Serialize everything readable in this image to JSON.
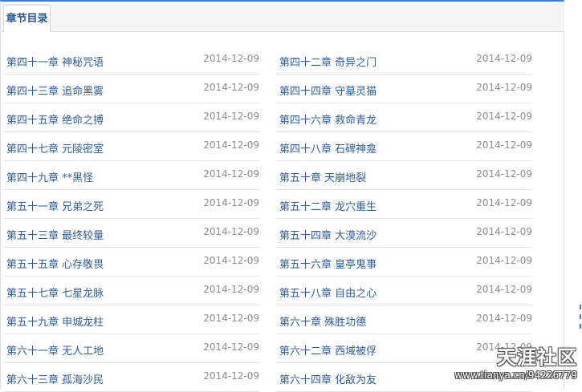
{
  "tab": {
    "label": "章节目录"
  },
  "chapters_left": [
    {
      "title": "第四十一章 神秘咒语",
      "date": "2014-12-09"
    },
    {
      "title": "第四十三章 追命黑雾",
      "date": "2014-12-09"
    },
    {
      "title": "第四十五章 绝命之搏",
      "date": "2014-12-09"
    },
    {
      "title": "第四十七章 元陵密室",
      "date": "2014-12-09"
    },
    {
      "title": "第四十九章 **黑怪",
      "date": "2014-12-09"
    },
    {
      "title": "第五十一章 兄弟之死",
      "date": "2014-12-09"
    },
    {
      "title": "第五十三章 最终较量",
      "date": "2014-12-09"
    },
    {
      "title": "第五十五章 心存敬畏",
      "date": "2014-12-09"
    },
    {
      "title": "第五十七章 七星龙脉",
      "date": "2014-12-09"
    },
    {
      "title": "第五十九章 申城龙柱",
      "date": "2014-12-09"
    },
    {
      "title": "第六十一章 无人工地",
      "date": "2014-12-09"
    },
    {
      "title": "第六十三章 孤海沙民",
      "date": "2014-12-09"
    }
  ],
  "chapters_right": [
    {
      "title": "第四十二章 奇异之门",
      "date": "2014-12-09"
    },
    {
      "title": "第四十四章 守墓灵猫",
      "date": "2014-12-09"
    },
    {
      "title": "第四十六章 救命青龙",
      "date": "2014-12-09"
    },
    {
      "title": "第四十八章 石碑神龛",
      "date": "2014-12-09"
    },
    {
      "title": "第五十章 天崩地裂",
      "date": "2014-12-09"
    },
    {
      "title": "第五十二章 龙穴重生",
      "date": "2014-12-09"
    },
    {
      "title": "第五十四章 大漠流沙",
      "date": "2014-12-09"
    },
    {
      "title": "第五十六章 皇亭鬼事",
      "date": "2014-12-09"
    },
    {
      "title": "第五十八章 自由之心",
      "date": "2014-12-09"
    },
    {
      "title": "第六十章 殊胜功德",
      "date": "2014-12-09"
    },
    {
      "title": "第六十二章 西域被俘",
      "date": "2014-12-09"
    },
    {
      "title": "第六十四章 化敌为友",
      "date": "2014-12-09"
    }
  ],
  "watermark": {
    "logo": "天涯社区",
    "url": "www.tianya.cn/94226779"
  },
  "colors": {
    "accent": "#3d7fc1",
    "link": "#2d5c9c",
    "date": "#8c8c8c"
  }
}
